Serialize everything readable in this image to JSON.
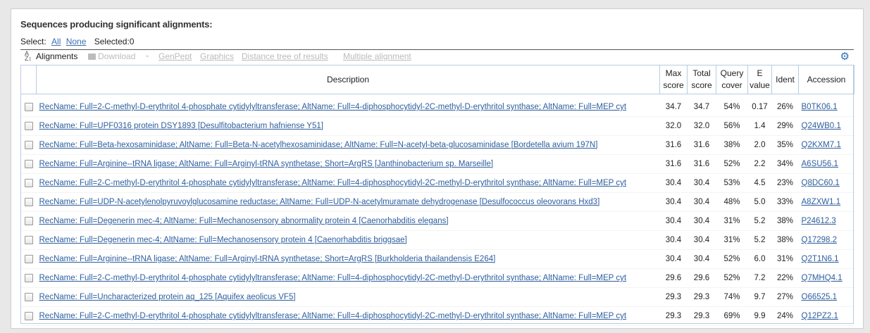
{
  "heading": "Sequences producing significant alignments:",
  "select": {
    "label": "Select:",
    "all": "All",
    "none": "None",
    "selected": "Selected:0"
  },
  "toolbar": {
    "alignments": "Alignments",
    "download": "Download",
    "genpept": "GenPept",
    "graphics": "Graphics",
    "distance_tree": "Distance tree of results",
    "multiple_alignment": "Multiple alignment"
  },
  "columns": {
    "description": "Description",
    "max_score": [
      "Max",
      "score"
    ],
    "total_score": [
      "Total",
      "score"
    ],
    "query_cover": [
      "Query",
      "cover"
    ],
    "e_value": [
      "E",
      "value"
    ],
    "ident": "Ident",
    "accession": "Accession"
  },
  "rows": [
    {
      "description": "RecName: Full=2-C-methyl-D-erythritol 4-phosphate cytidylyltransferase; AltName: Full=4-diphosphocytidyl-2C-methyl-D-erythritol synthase; AltName: Full=MEP cyt",
      "max": "34.7",
      "total": "34.7",
      "cover": "54%",
      "e": "0.17",
      "ident": "26%",
      "acc": "B0TK06.1"
    },
    {
      "description": "RecName: Full=UPF0316 protein DSY1893 [Desulfitobacterium hafniense Y51]",
      "max": "32.0",
      "total": "32.0",
      "cover": "56%",
      "e": "1.4",
      "ident": "29%",
      "acc": "Q24WB0.1"
    },
    {
      "description": "RecName: Full=Beta-hexosaminidase; AltName: Full=Beta-N-acetylhexosaminidase; AltName: Full=N-acetyl-beta-glucosaminidase [Bordetella avium 197N]",
      "max": "31.6",
      "total": "31.6",
      "cover": "38%",
      "e": "2.0",
      "ident": "35%",
      "acc": "Q2KXM7.1"
    },
    {
      "description": "RecName: Full=Arginine--tRNA ligase; AltName: Full=Arginyl-tRNA synthetase; Short=ArgRS [Janthinobacterium sp. Marseille]",
      "max": "31.6",
      "total": "31.6",
      "cover": "52%",
      "e": "2.2",
      "ident": "34%",
      "acc": "A6SU56.1"
    },
    {
      "description": "RecName: Full=2-C-methyl-D-erythritol 4-phosphate cytidylyltransferase; AltName: Full=4-diphosphocytidyl-2C-methyl-D-erythritol synthase; AltName: Full=MEP cyt",
      "max": "30.4",
      "total": "30.4",
      "cover": "53%",
      "e": "4.5",
      "ident": "23%",
      "acc": "Q8DC60.1"
    },
    {
      "description": "RecName: Full=UDP-N-acetylenolpyruvoylglucosamine reductase; AltName: Full=UDP-N-acetylmuramate dehydrogenase [Desulfococcus oleovorans Hxd3]",
      "max": "30.4",
      "total": "30.4",
      "cover": "48%",
      "e": "5.0",
      "ident": "33%",
      "acc": "A8ZXW1.1"
    },
    {
      "description": "RecName: Full=Degenerin mec-4; AltName: Full=Mechanosensory abnormality protein 4 [Caenorhabditis elegans]",
      "max": "30.4",
      "total": "30.4",
      "cover": "31%",
      "e": "5.2",
      "ident": "38%",
      "acc": "P24612.3"
    },
    {
      "description": "RecName: Full=Degenerin mec-4; AltName: Full=Mechanosensory protein 4 [Caenorhabditis briggsae]",
      "max": "30.4",
      "total": "30.4",
      "cover": "31%",
      "e": "5.2",
      "ident": "38%",
      "acc": "Q17298.2"
    },
    {
      "description": "RecName: Full=Arginine--tRNA ligase; AltName: Full=Arginyl-tRNA synthetase; Short=ArgRS [Burkholderia thailandensis E264]",
      "max": "30.4",
      "total": "30.4",
      "cover": "52%",
      "e": "6.0",
      "ident": "31%",
      "acc": "Q2T1N6.1"
    },
    {
      "description": "RecName: Full=2-C-methyl-D-erythritol 4-phosphate cytidylyltransferase; AltName: Full=4-diphosphocytidyl-2C-methyl-D-erythritol synthase; AltName: Full=MEP cyt",
      "max": "29.6",
      "total": "29.6",
      "cover": "52%",
      "e": "7.2",
      "ident": "22%",
      "acc": "Q7MHQ4.1"
    },
    {
      "description": "RecName: Full=Uncharacterized protein aq_125 [Aquifex aeolicus VF5]",
      "max": "29.3",
      "total": "29.3",
      "cover": "74%",
      "e": "9.7",
      "ident": "27%",
      "acc": "O66525.1"
    },
    {
      "description": "RecName: Full=2-C-methyl-D-erythritol 4-phosphate cytidylyltransferase; AltName: Full=4-diphosphocytidyl-2C-methyl-D-erythritol synthase; AltName: Full=MEP cyt",
      "max": "29.3",
      "total": "29.3",
      "cover": "69%",
      "e": "9.9",
      "ident": "24%",
      "acc": "Q12PZ2.1"
    }
  ]
}
